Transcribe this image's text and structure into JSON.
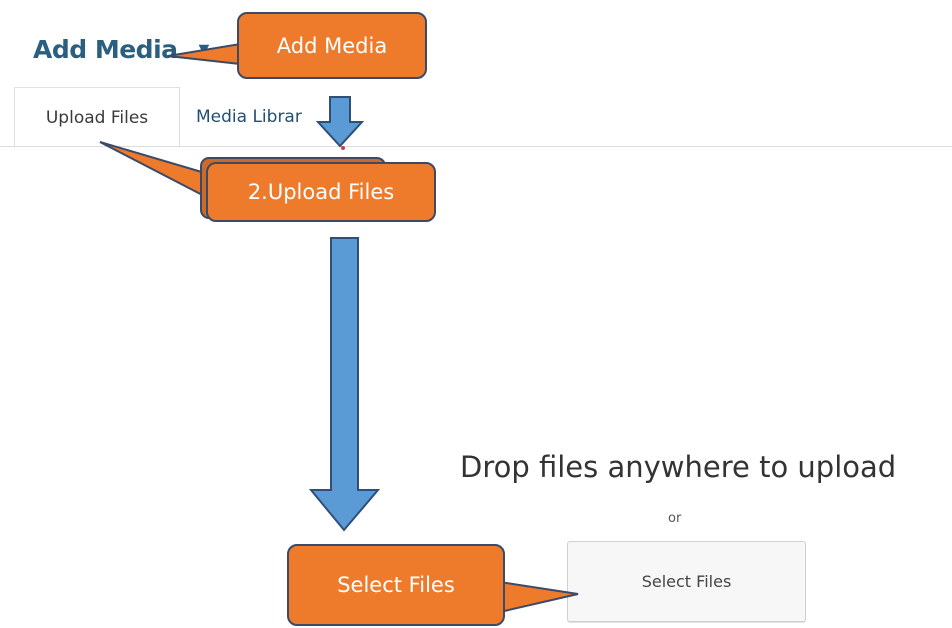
{
  "header": {
    "title": "Add Media",
    "caret": "▼"
  },
  "tabs": [
    {
      "label": "Upload Files",
      "active": true
    },
    {
      "label": "Media Library",
      "visible_text": "Media Librar",
      "active": false
    }
  ],
  "upload": {
    "drop_text": "Drop files anywhere to upload",
    "or_text": "or",
    "button_label": "Select Files"
  },
  "annotations": {
    "add_media": "Add Media",
    "upload_files": "2.Upload Files",
    "select_files": "Select Files"
  },
  "colors": {
    "title": "#2a5f7f",
    "callout_fill": "#ee7b2c",
    "callout_border": "#3b4a66",
    "arrow_fill": "#5b9bd5",
    "arrow_border": "#2f4f79"
  }
}
